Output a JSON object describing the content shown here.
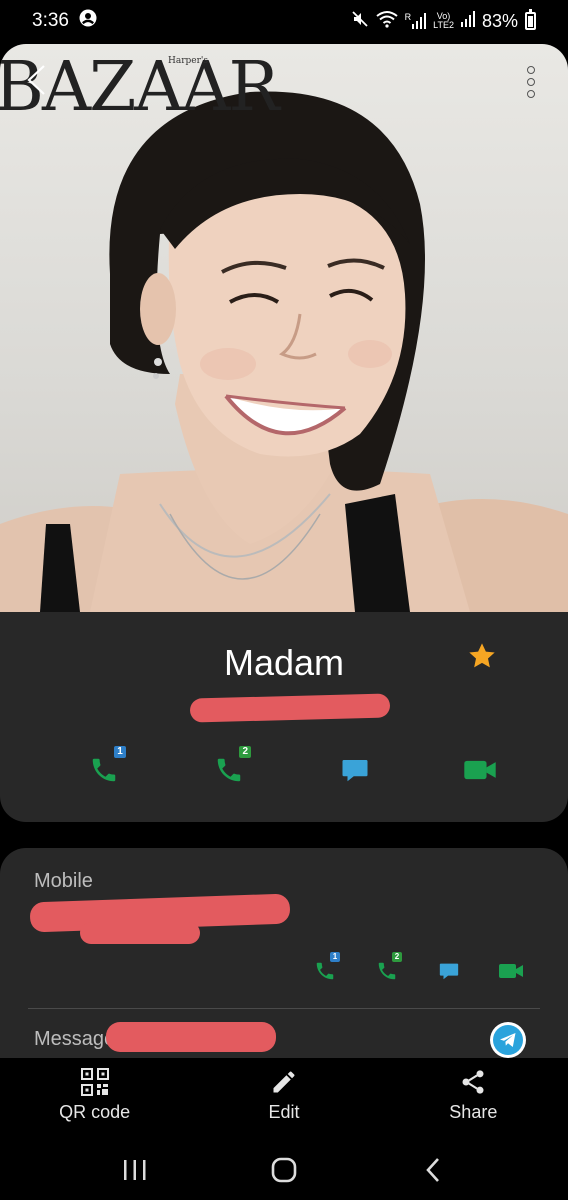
{
  "status_bar": {
    "time": "3:36",
    "battery": "83%",
    "network_r": "R",
    "volte_line1": "Vo)",
    "volte_line2": "LTE2"
  },
  "photo": {
    "masthead": "BAZAAR",
    "masthead_small": "Harper's"
  },
  "contact": {
    "name": "Madam",
    "favorite_color": "#f6a623"
  },
  "actions": {
    "sim1_badge": "1",
    "sim2_badge": "2",
    "call_color": "#1aa150",
    "message_color": "#3aa3d8",
    "video_color": "#1aa150"
  },
  "details": {
    "mobile_label": "Mobile",
    "messenger_label": "Message"
  },
  "toolbar": {
    "qr_label": "QR code",
    "edit_label": "Edit",
    "share_label": "Share"
  }
}
